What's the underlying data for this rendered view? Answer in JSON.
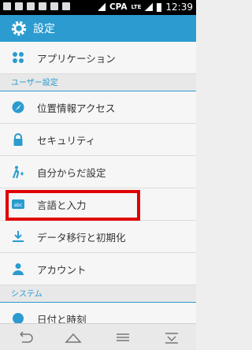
{
  "status_bar": {
    "carrier": "CPA",
    "network": "LTE",
    "time": "12:39"
  },
  "action_bar": {
    "title": "設定",
    "icon": "gear-icon"
  },
  "items_top": [
    {
      "label": "アプリケーション",
      "icon": "apps-icon"
    }
  ],
  "user_section": {
    "title": "ユーザー設定",
    "items": [
      {
        "label": "位置情報アクセス",
        "icon": "location-icon"
      },
      {
        "label": "セキュリティ",
        "icon": "lock-icon"
      },
      {
        "label": "自分からだ設定",
        "icon": "body-icon"
      },
      {
        "label": "言語と入力",
        "icon": "keyboard-icon"
      },
      {
        "label": "データ移行と初期化",
        "icon": "download-icon"
      },
      {
        "label": "アカウント",
        "icon": "person-icon"
      }
    ]
  },
  "system_section": {
    "title": "システム",
    "items": [
      {
        "label": "日付と時刻",
        "icon": "clock-icon"
      }
    ]
  },
  "accent_color": "#2b9bd0",
  "highlight_color": "#e00000"
}
